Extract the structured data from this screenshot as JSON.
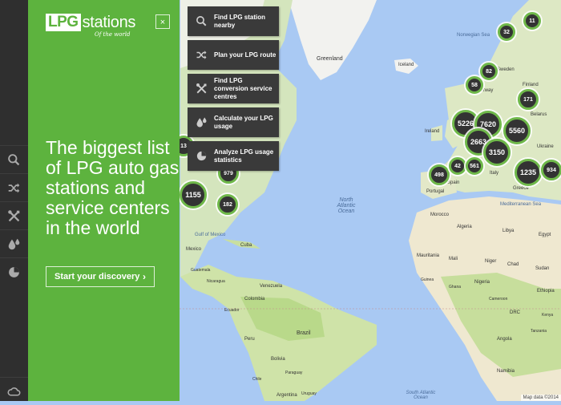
{
  "brand": {
    "logo_lpg": "LPG",
    "logo_stations": "stations",
    "tagline": "Of the world"
  },
  "panel": {
    "close_label": "×",
    "headline": "The biggest list of LPG auto gas stations and service centers in the world",
    "cta_label": "Start your discovery",
    "cta_icon": "chevron-right-icon"
  },
  "rail": [
    {
      "icon": "search-icon"
    },
    {
      "icon": "shuffle-route-icon"
    },
    {
      "icon": "tools-icon"
    },
    {
      "icon": "drops-icon"
    },
    {
      "icon": "pie-chart-icon"
    },
    {
      "icon": "cloud-icon"
    }
  ],
  "menu": [
    {
      "label": "Find LPG station nearby",
      "icon": "search-icon"
    },
    {
      "label": "Plan your LPG route",
      "icon": "shuffle-route-icon"
    },
    {
      "label": "Find LPG conversion service centres",
      "icon": "tools-icon"
    },
    {
      "label": "Calculate your LPG usage",
      "icon": "drops-icon"
    },
    {
      "label": "Analyze LPG usage statistics",
      "icon": "pie-chart-icon"
    }
  ],
  "clusters": [
    "11",
    "32",
    "82",
    "58",
    "171",
    "5226",
    "7620",
    "5560",
    "2663",
    "3150",
    "498",
    "42",
    "561",
    "1235",
    "934",
    "13",
    "979",
    "1155",
    "182"
  ],
  "map_labels": {
    "greenland": "Greenland",
    "iceland": "Iceland",
    "norwegian_sea": "Norwegian Sea",
    "sweden": "Sweden",
    "norway": "Norway",
    "finland": "Finland",
    "belarus": "Belarus",
    "ireland": "Ireland",
    "ukraine": "Ukraine",
    "italy": "Italy",
    "portugal": "Portugal",
    "spain": "Spain",
    "greece": "Greece",
    "mediterranean_sea": "Mediterranean Sea",
    "north_atlantic_ocean": "North Atlantic Ocean",
    "morocco": "Morocco",
    "algeria": "Algeria",
    "libya": "Libya",
    "egypt": "Egypt",
    "mauritania": "Mauritania",
    "mali": "Mali",
    "niger": "Niger",
    "chad": "Chad",
    "sudan": "Sudan",
    "nigeria": "Nigeria",
    "ethiopia": "Ethiopia",
    "drc": "DRC",
    "angola": "Angola",
    "namibia": "Namibia",
    "gulf_of_mexico": "Gulf of Mexico",
    "cuba": "Cuba",
    "mexico": "Mexico",
    "venezuela": "Venezuela",
    "colombia": "Colombia",
    "peru": "Peru",
    "brazil": "Brazil",
    "bolivia": "Bolivia",
    "south_atlantic_ocean": "South Atlantic Ocean",
    "argentina": "Argentina",
    "guatemala": "Guatemala",
    "nicaragua": "Nicaragua",
    "ecuador": "Ecuador",
    "guinea": "Guinea",
    "ghana": "Ghana",
    "cameroon": "Cameroon",
    "kenya": "Kenya",
    "tanzania": "Tanzania",
    "chile": "Chile",
    "paraguay": "Paraguay",
    "uruguay": "Uruguay"
  },
  "attribution": "Map data ©2014"
}
